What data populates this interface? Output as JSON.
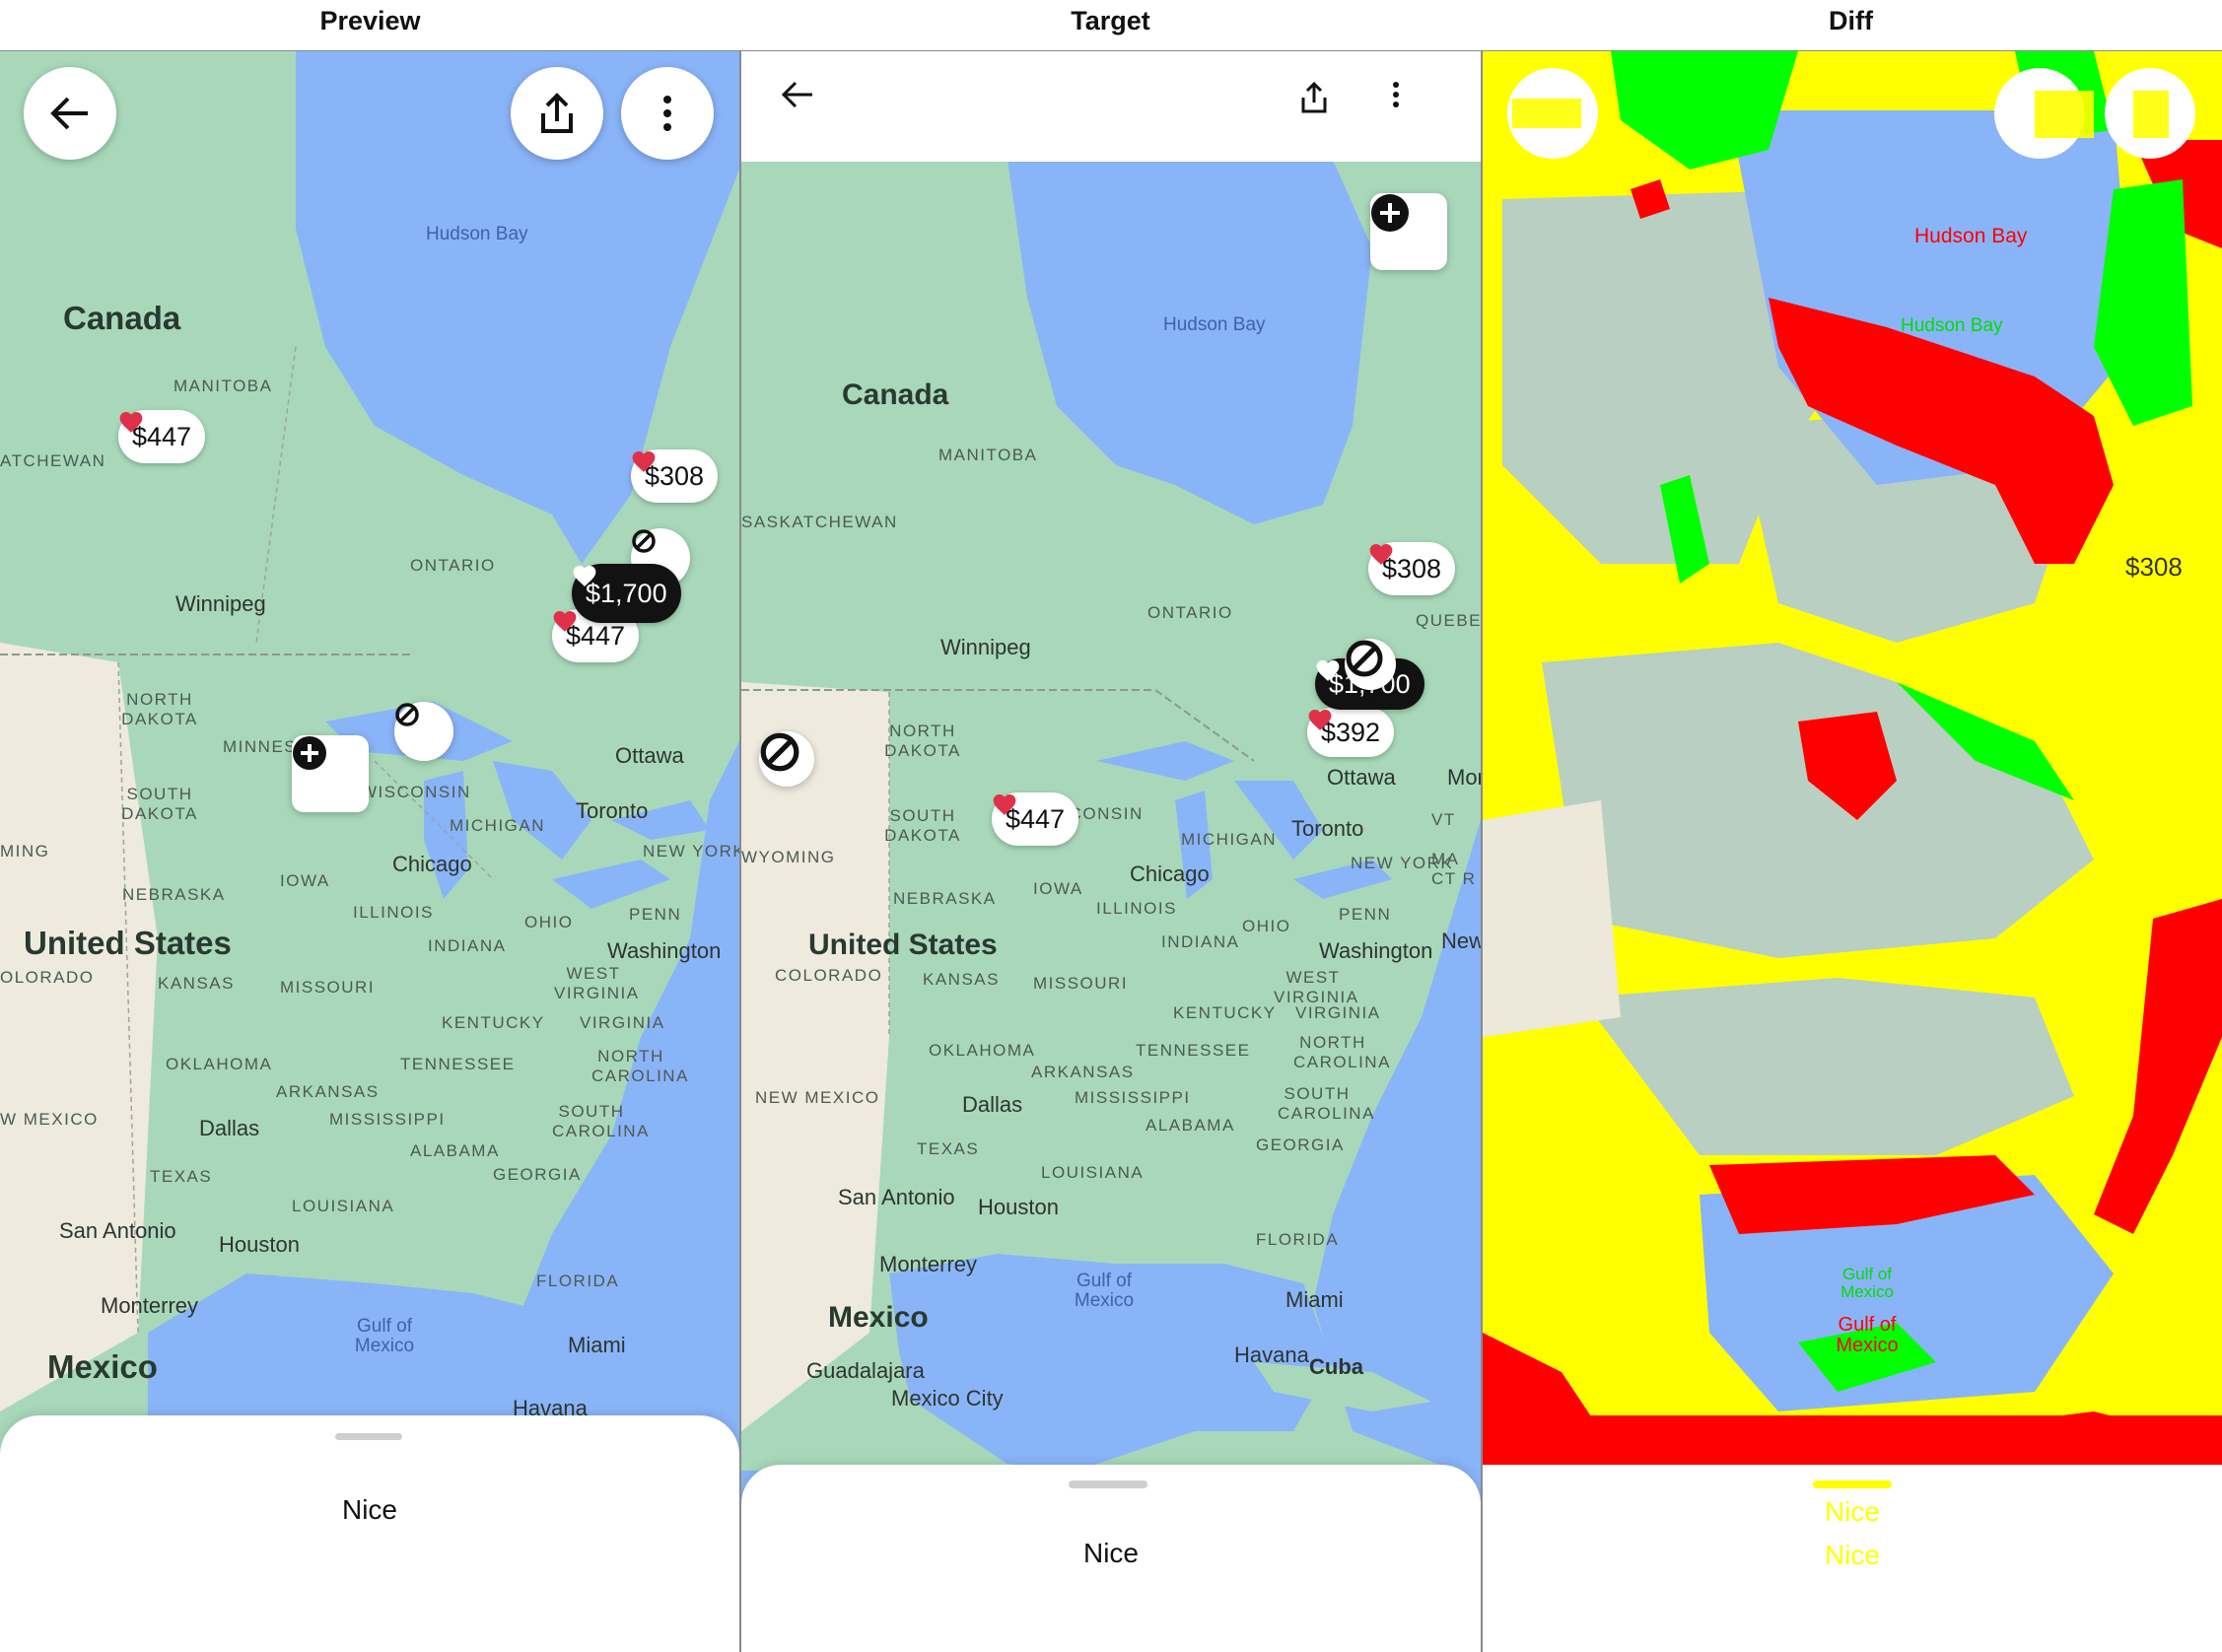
{
  "panels": {
    "preview": "Preview",
    "target": "Target",
    "diff": "Diff"
  },
  "map": {
    "country_canada": "Canada",
    "country_us": "United States",
    "country_mexico": "Mexico",
    "water_hudson": "Hudson Bay",
    "water_gulf": "Gulf of Mexico",
    "states": {
      "manitoba": "MANITOBA",
      "saskatchewan": "SASKATCHEWAN",
      "atchewan": "ATCHEWAN",
      "ontario": "ONTARIO",
      "quebec": "QUEBEC",
      "north_dakota": "NORTH DAKOTA",
      "south_dakota": "SOUTH DAKOTA",
      "minnesota": "MINNES",
      "wisconsin": "WISCONSIN",
      "michigan": "MICHIGAN",
      "wyoming": "WYOMING",
      "ming": "MING",
      "nebraska": "NEBRASKA",
      "iowa": "IOWA",
      "illinois": "ILLINOIS",
      "indiana": "INDIANA",
      "ohio": "OHIO",
      "penn": "PENN",
      "new_york": "NEW YORK",
      "colorado": "COLORADO",
      "olorado": "OLORADO",
      "kansas": "KANSAS",
      "missouri": "MISSOURI",
      "west_virginia": "WEST VIRGINIA",
      "virginia": "VIRGINIA",
      "kentucky": "KENTUCKY",
      "oklahoma": "OKLAHOMA",
      "tennessee": "TENNESSEE",
      "north_carolina": "NORTH CAROLINA",
      "new_mexico": "NEW MEXICO",
      "w_mexico": "W MEXICO",
      "arkansas": "ARKANSAS",
      "mississippi": "MISSISSIPPI",
      "south_carolina": "SOUTH CAROLINA",
      "alabama": "ALABAMA",
      "georgia": "GEORGIA",
      "texas": "TEXAS",
      "louisiana": "LOUISIANA",
      "florida": "FLORIDA",
      "vt": "VT",
      "ma": "MA",
      "ct": "CT R"
    },
    "cities": {
      "winnipeg": "Winnipeg",
      "ottawa": "Ottawa",
      "toronto": "Toronto",
      "chicago": "Chicago",
      "washington": "Washington",
      "dallas": "Dallas",
      "san_antonio": "San Antonio",
      "houston": "Houston",
      "monterrey": "Monterrey",
      "miami": "Miami",
      "havana": "Havana",
      "cuba": "Cuba",
      "guadalajara": "Guadalajara",
      "mexico_city": "Mexico City",
      "new": "New",
      "mor": "Mor"
    }
  },
  "pins": {
    "p447": "$447",
    "p308": "$308",
    "p1700": "$1,700",
    "p392": "$392"
  },
  "sheet": {
    "text": "Nice"
  },
  "colors": {
    "land": "#a8d8b9",
    "land_light": "#f2efe6",
    "water": "#8ab4f8",
    "heart": "#e0314b",
    "diff_yellow": "#ffff00",
    "diff_red": "#ff0000",
    "diff_green": "#00ff00"
  },
  "icons": [
    "back-arrow-icon",
    "share-icon",
    "more-vertical-icon",
    "plus-icon",
    "block-icon",
    "heart-icon"
  ]
}
